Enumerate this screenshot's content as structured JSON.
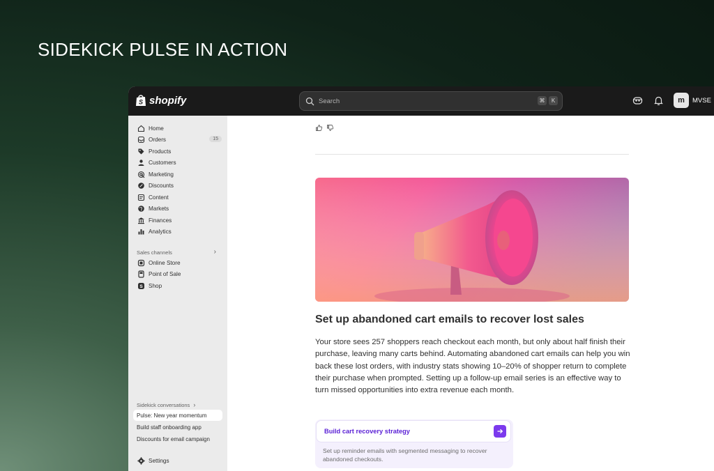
{
  "hero": {
    "title": "SIDEKICK PULSE IN ACTION"
  },
  "topbar": {
    "logo_text": "shopify",
    "search_placeholder": "Search",
    "shortcut_keys": [
      "⌘",
      "K"
    ],
    "store_initials": "m",
    "store_name": "MVSE"
  },
  "sidebar": {
    "items": [
      {
        "label": "Home",
        "icon": "home-icon"
      },
      {
        "label": "Orders",
        "icon": "inbox-icon",
        "badge": "15"
      },
      {
        "label": "Products",
        "icon": "tag-icon"
      },
      {
        "label": "Customers",
        "icon": "person-icon"
      },
      {
        "label": "Marketing",
        "icon": "target-icon"
      },
      {
        "label": "Discounts",
        "icon": "discount-icon"
      },
      {
        "label": "Content",
        "icon": "content-icon"
      },
      {
        "label": "Markets",
        "icon": "globe-icon"
      },
      {
        "label": "Finances",
        "icon": "bank-icon"
      },
      {
        "label": "Analytics",
        "icon": "bar-chart-icon"
      }
    ],
    "sales_channels_label": "Sales channels",
    "channels": [
      {
        "label": "Online Store",
        "icon": "store-icon"
      },
      {
        "label": "Point of Sale",
        "icon": "pos-icon"
      },
      {
        "label": "Shop",
        "icon": "shop-icon"
      }
    ],
    "conversations_label": "Sidekick conversations",
    "conversations": [
      {
        "label": "Pulse: New year momentum",
        "active": true
      },
      {
        "label": "Build staff onboarding app",
        "active": false
      },
      {
        "label": "Discounts for email campaign",
        "active": false
      }
    ],
    "settings_label": "Settings"
  },
  "main": {
    "title": "Set up abandoned cart emails to recover lost sales",
    "body": "Your store sees 257 shoppers reach checkout each month, but only about half finish their purchase, leaving many carts behind. Automating abandoned cart emails can help you win back these lost orders, with industry stats showing 10–20% of shopper return to complete their purchase when prompted. Setting up a follow-up email series is an effective way to turn missed opportunities into extra revenue each month.",
    "cta_label": "Build cart recovery strategy",
    "cta_subtext": "Set up reminder emails with segmented messaging to recover abandoned checkouts."
  },
  "colors": {
    "accent": "#7c3aed",
    "topbar": "#1a1a1a",
    "sidebar": "#ebebeb"
  }
}
